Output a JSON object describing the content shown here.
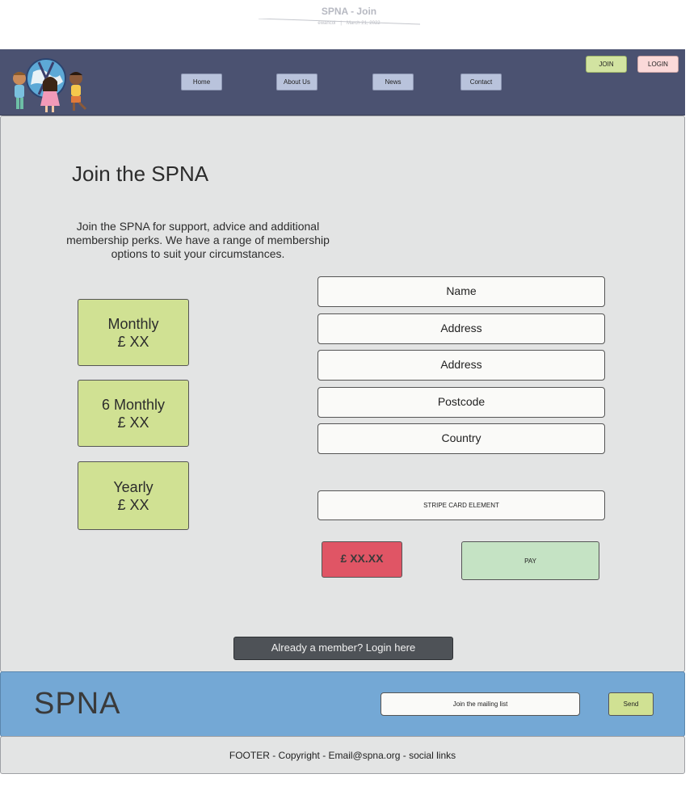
{
  "doc": {
    "title": "SPNA - Join",
    "author": "ewancol",
    "date": "March 21, 2022"
  },
  "header": {
    "nav": [
      "Home",
      "About Us",
      "News",
      "Contact"
    ],
    "join_label": "JOIN",
    "login_label": "LOGIN"
  },
  "main": {
    "heading": "Join the SPNA",
    "intro": "Join the SPNA for support, advice and additional membership perks. We have a range of membership options to suit your circumstances.",
    "plans": [
      {
        "name": "Monthly",
        "price": "£ XX"
      },
      {
        "name": "6 Monthly",
        "price": "£ XX"
      },
      {
        "name": "Yearly",
        "price": "£ XX"
      }
    ],
    "fields": [
      "Name",
      "Address",
      "Address",
      "Postcode",
      "Country"
    ],
    "stripe_label": "STRIPE CARD ELEMENT",
    "total": "£ XX.XX",
    "pay_label": "PAY",
    "login_link": "Already a member? Login here"
  },
  "band": {
    "brand": "SPNA",
    "mailing_list_label": "Join the mailing list",
    "send_label": "Send"
  },
  "footer": {
    "text": "FOOTER - Copyright - Email@spna.org - social links"
  },
  "colors": {
    "header_bg": "#4b5271",
    "main_bg": "#e3e4e4",
    "plan_green": "#d0e193",
    "price_red": "#e05565",
    "pay_green": "#c5e3c4",
    "band_blue": "#74a8d5"
  }
}
